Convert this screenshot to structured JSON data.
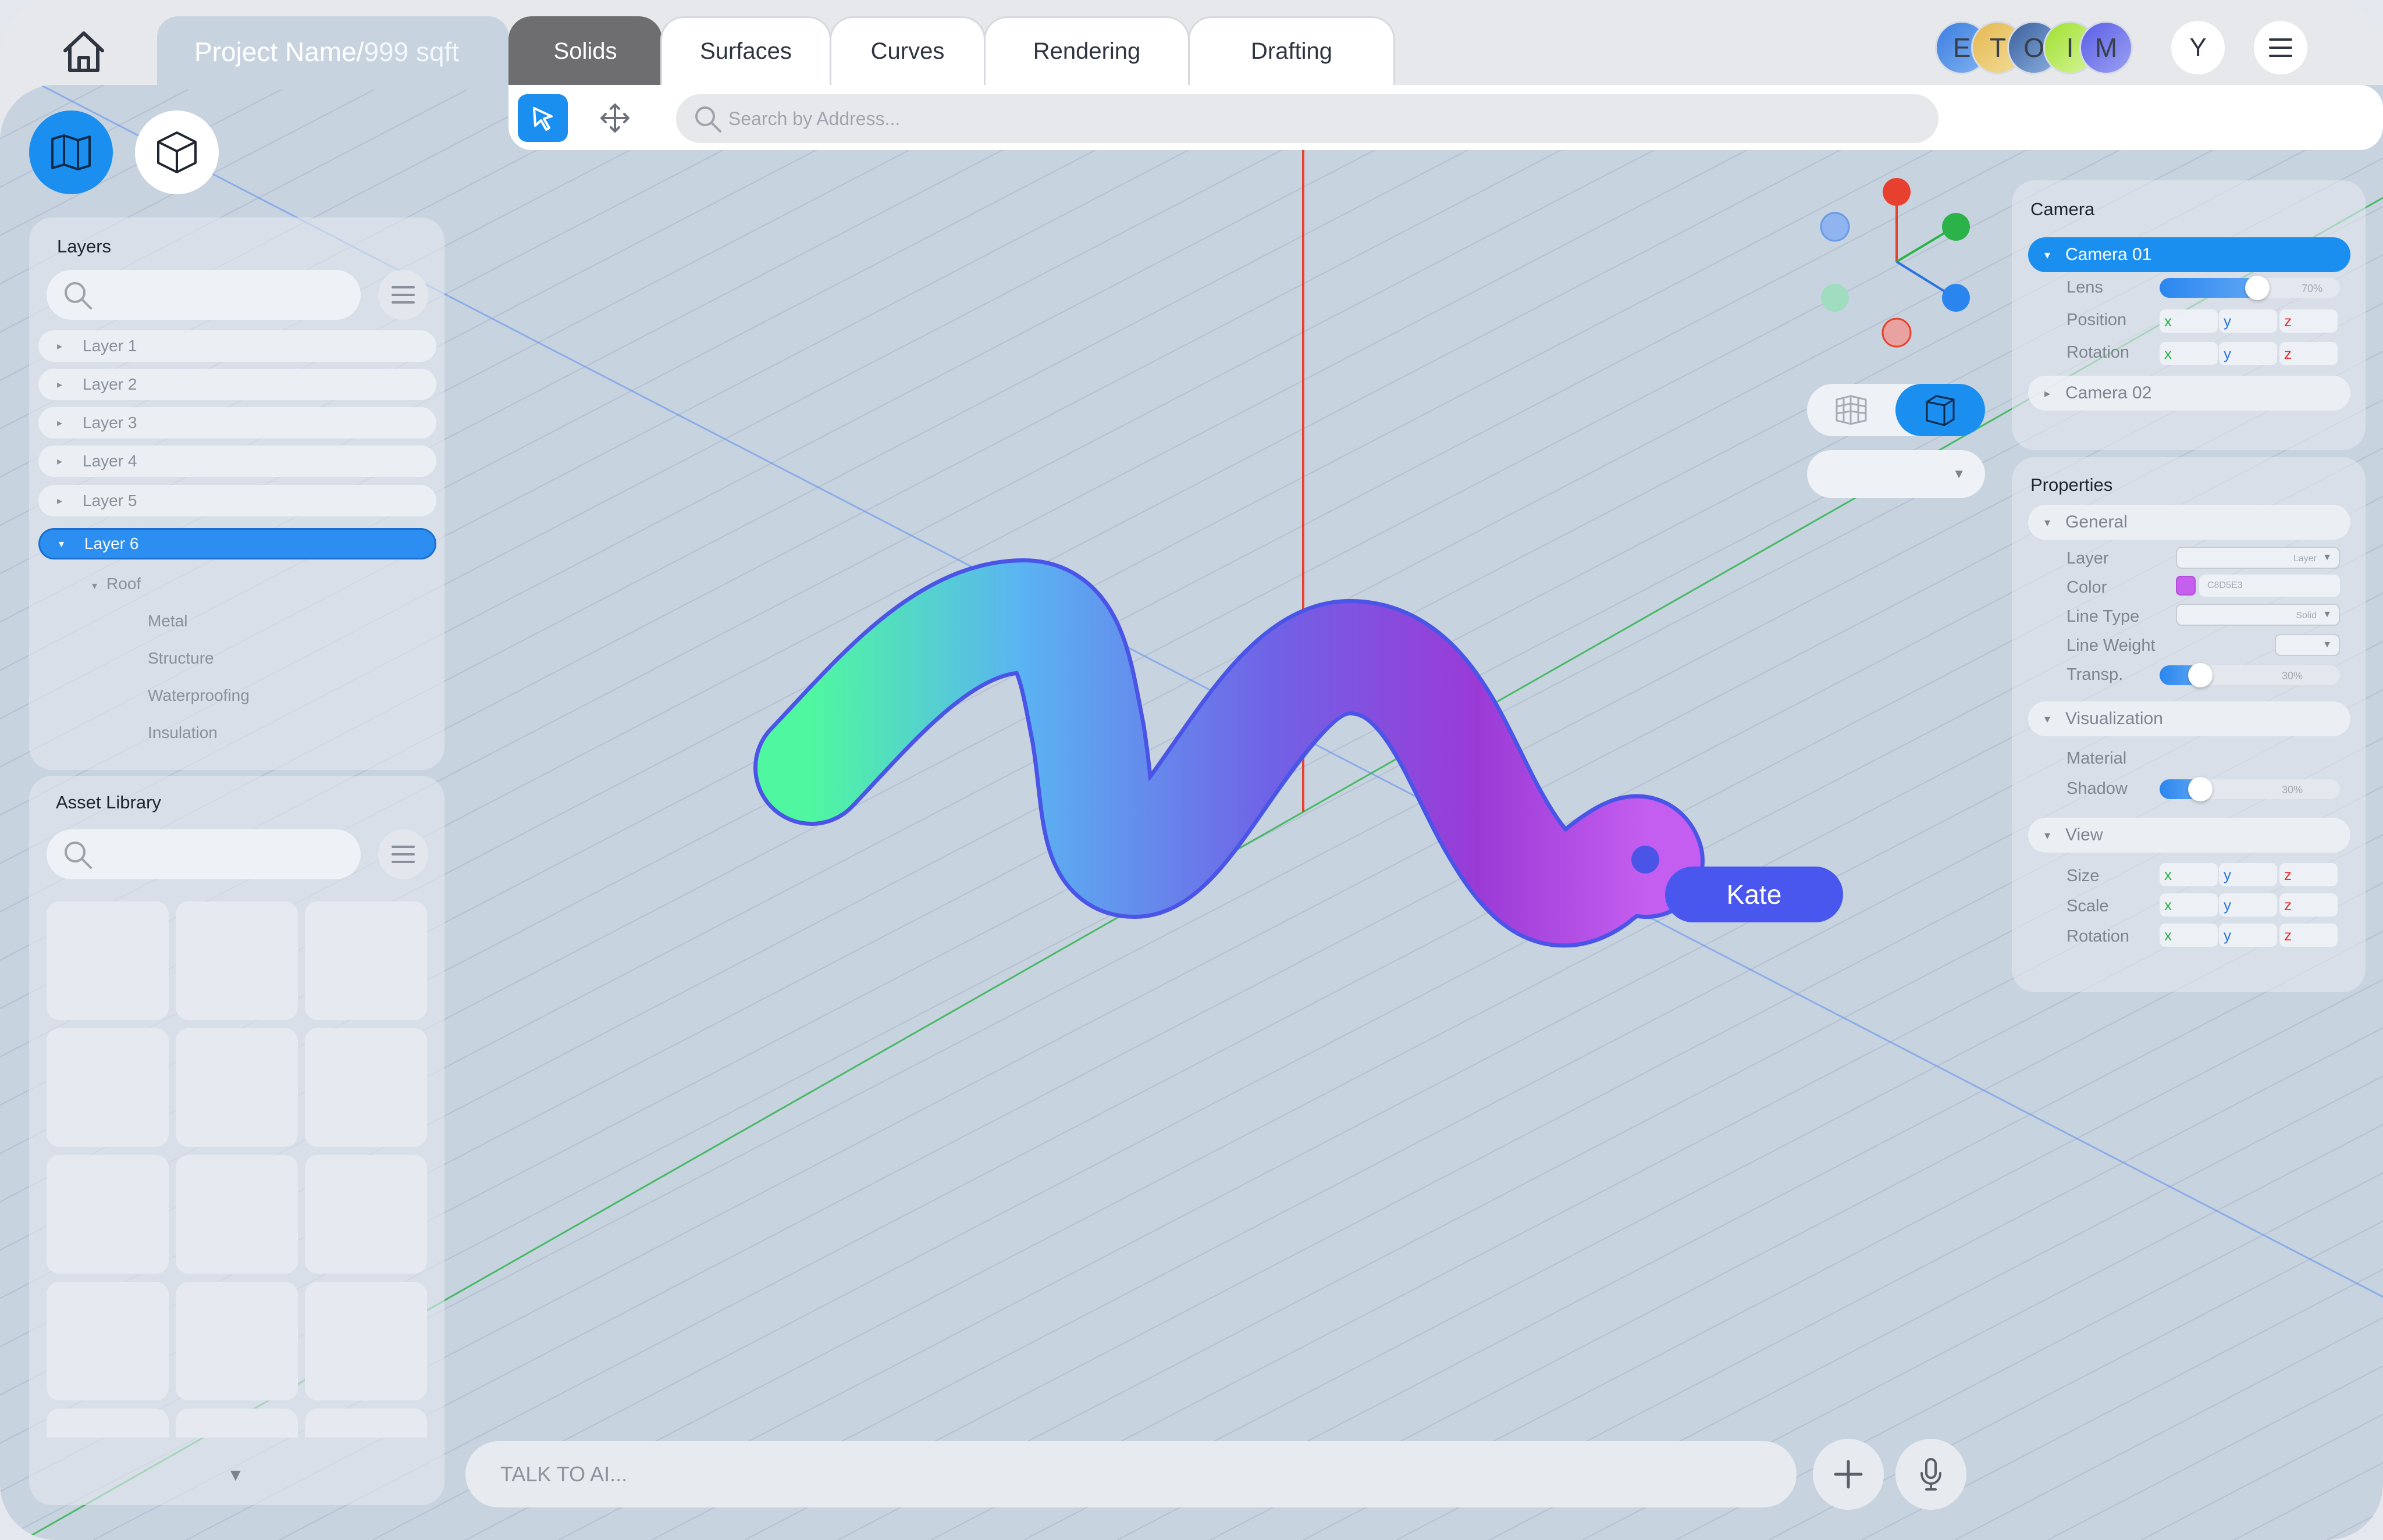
{
  "header": {
    "project_name": "Project Name",
    "project_separator": "/",
    "project_size": "999 sqft",
    "tabs": [
      {
        "label": "Solids",
        "active": true
      },
      {
        "label": "Surfaces",
        "active": false
      },
      {
        "label": "Curves",
        "active": false
      },
      {
        "label": "Rendering",
        "active": false
      },
      {
        "label": "Drafting",
        "active": false
      }
    ],
    "avatars": [
      {
        "initial": "E",
        "color": "#4d8fe8"
      },
      {
        "initial": "T",
        "color": "#e9c86a"
      },
      {
        "initial": "O",
        "color": "#4a6fa8"
      },
      {
        "initial": "I",
        "color": "#b7e84e"
      },
      {
        "initial": "M",
        "color": "#6a6ee8"
      }
    ],
    "user_initial": "Y"
  },
  "toolbar": {
    "search_placeholder": "Search by Address..."
  },
  "layers_panel": {
    "title": "Layers",
    "layers": [
      {
        "label": "Layer 1",
        "expanded": false,
        "active": false
      },
      {
        "label": "Layer 2",
        "expanded": false,
        "active": false
      },
      {
        "label": "Layer 3",
        "expanded": false,
        "active": false
      },
      {
        "label": "Layer 4",
        "expanded": false,
        "active": false
      },
      {
        "label": "Layer 5",
        "expanded": false,
        "active": false
      },
      {
        "label": "Layer 6",
        "expanded": true,
        "active": true
      }
    ],
    "tree": {
      "group": "Roof",
      "children": [
        "Metal",
        "Structure",
        "Waterproofing",
        "Insulation"
      ]
    }
  },
  "asset_library": {
    "title": "Asset Library"
  },
  "ai_bar": {
    "placeholder": "TALK TO AI..."
  },
  "viewport": {
    "cursor_label": "Kate",
    "axis_colors": {
      "x": "#2bb34a",
      "y": "#5b8ff0",
      "z": "#e8402e"
    },
    "shape_gradient": [
      "#4ff7a0",
      "#5ab4f2",
      "#7062e6",
      "#9b3ad6",
      "#c45ef0"
    ],
    "shape_outline": "#4a55e8"
  },
  "camera_panel": {
    "title": "Camera",
    "cameras": [
      {
        "label": "Camera 01",
        "expanded": true,
        "active": true
      },
      {
        "label": "Camera 02",
        "expanded": false,
        "active": false
      }
    ],
    "fields": {
      "lens_label": "Lens",
      "lens_value": "70%",
      "lens_level": 0.7,
      "position_label": "Position",
      "rotation_label": "Rotation"
    },
    "axis_letters": {
      "x": "x",
      "y": "y",
      "z": "z"
    }
  },
  "properties_panel": {
    "title": "Properties",
    "general": {
      "label": "General",
      "layer_label": "Layer",
      "layer_value": "Layer",
      "color_label": "Color",
      "color_value": "C8D5E3",
      "color_swatch": "#c65ef0",
      "line_type_label": "Line Type",
      "line_type_value": "Solid",
      "line_weight_label": "Line Weight",
      "transp_label": "Transp.",
      "transp_value": "30%",
      "transp_level": 0.3
    },
    "visualization": {
      "label": "Visualization",
      "material_label": "Material",
      "shadow_label": "Shadow",
      "shadow_value": "30%",
      "shadow_level": 0.3
    },
    "view": {
      "label": "View",
      "size_label": "Size",
      "scale_label": "Scale",
      "rotation_label": "Rotation"
    }
  }
}
